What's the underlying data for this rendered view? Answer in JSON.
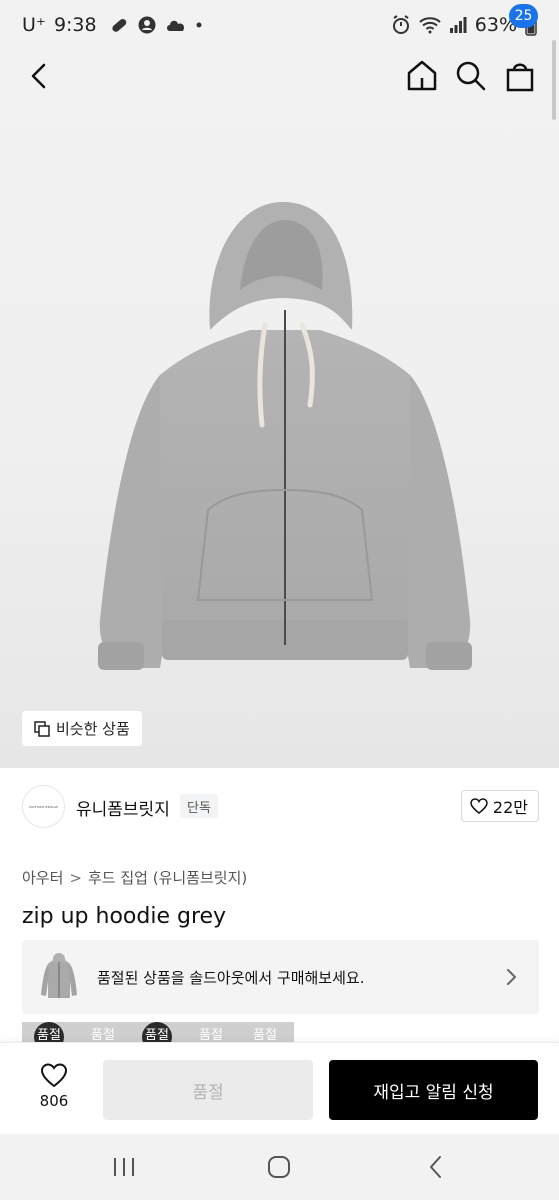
{
  "status_bar": {
    "carrier": "U⁺",
    "time": "9:38",
    "battery": "63%"
  },
  "header": {
    "cart_count": "25"
  },
  "hero": {
    "similar_label": "비슷한 상품"
  },
  "brand": {
    "logo_text": "UNIFORM BRIDGE",
    "name": "유니폼브릿지",
    "badge": "단독",
    "like_count": "22만"
  },
  "breadcrumb": {
    "category": "아우터",
    "separator": ">",
    "subcategory": "후드 집업 (유니폼브릿지)"
  },
  "product": {
    "title": "zip up hoodie grey"
  },
  "soldout_banner": {
    "text": "품절된 상품을 솔드아웃에서 구매해보세요."
  },
  "swatches": [
    {
      "label": "품절",
      "dark": true
    },
    {
      "label": "품절",
      "dark": false
    },
    {
      "label": "품절",
      "dark": true
    },
    {
      "label": "품절",
      "dark": false
    },
    {
      "label": "품절",
      "dark": false
    }
  ],
  "bottom_bar": {
    "wish_count": "806",
    "soldout_label": "품절",
    "restock_label": "재입고 알림 신청"
  },
  "colors": {
    "accent": "#1a73e8",
    "primary_button": "#000000",
    "disabled_button": "#ebebeb"
  }
}
